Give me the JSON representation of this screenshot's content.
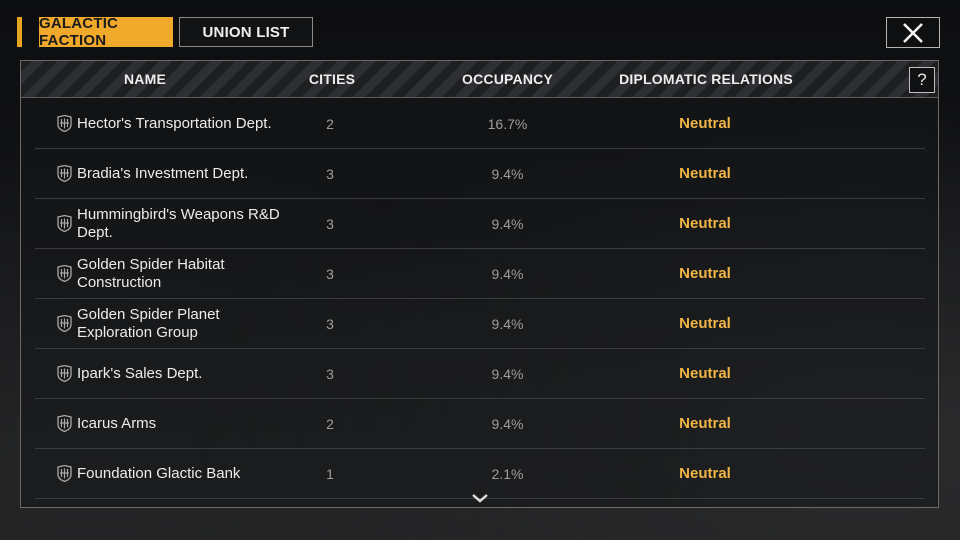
{
  "tabs": {
    "galactic_faction": "GALACTIC FACTION",
    "union_list": "UNION LIST"
  },
  "columns": {
    "name": "NAME",
    "cities": "CITIES",
    "occupancy": "OCCUPANCY",
    "relations": "DIPLOMATIC RELATIONS"
  },
  "help_label": "?",
  "rows": [
    {
      "name": "Hector's Transportation Dept.",
      "cities": "2",
      "occupancy": "16.7%",
      "relation": "Neutral"
    },
    {
      "name": "Bradia's Investment Dept.",
      "cities": "3",
      "occupancy": "9.4%",
      "relation": "Neutral"
    },
    {
      "name": "Hummingbird's Weapons R&D Dept.",
      "cities": "3",
      "occupancy": "9.4%",
      "relation": "Neutral"
    },
    {
      "name": "Golden Spider Habitat Construction",
      "cities": "3",
      "occupancy": "9.4%",
      "relation": "Neutral"
    },
    {
      "name": "Golden Spider Planet Exploration Group",
      "cities": "3",
      "occupancy": "9.4%",
      "relation": "Neutral"
    },
    {
      "name": "Ipark's Sales Dept.",
      "cities": "3",
      "occupancy": "9.4%",
      "relation": "Neutral"
    },
    {
      "name": "Icarus Arms",
      "cities": "2",
      "occupancy": "9.4%",
      "relation": "Neutral"
    },
    {
      "name": "Foundation Glactic Bank",
      "cities": "1",
      "occupancy": "2.1%",
      "relation": "Neutral"
    }
  ],
  "colors": {
    "accent": "#f0a92b",
    "relation_neutral": "#f0b545"
  },
  "icons": {
    "close": "close-icon",
    "help": "help-icon",
    "faction": "faction-emblem-icon",
    "scroll": "chevron-down-icon"
  }
}
